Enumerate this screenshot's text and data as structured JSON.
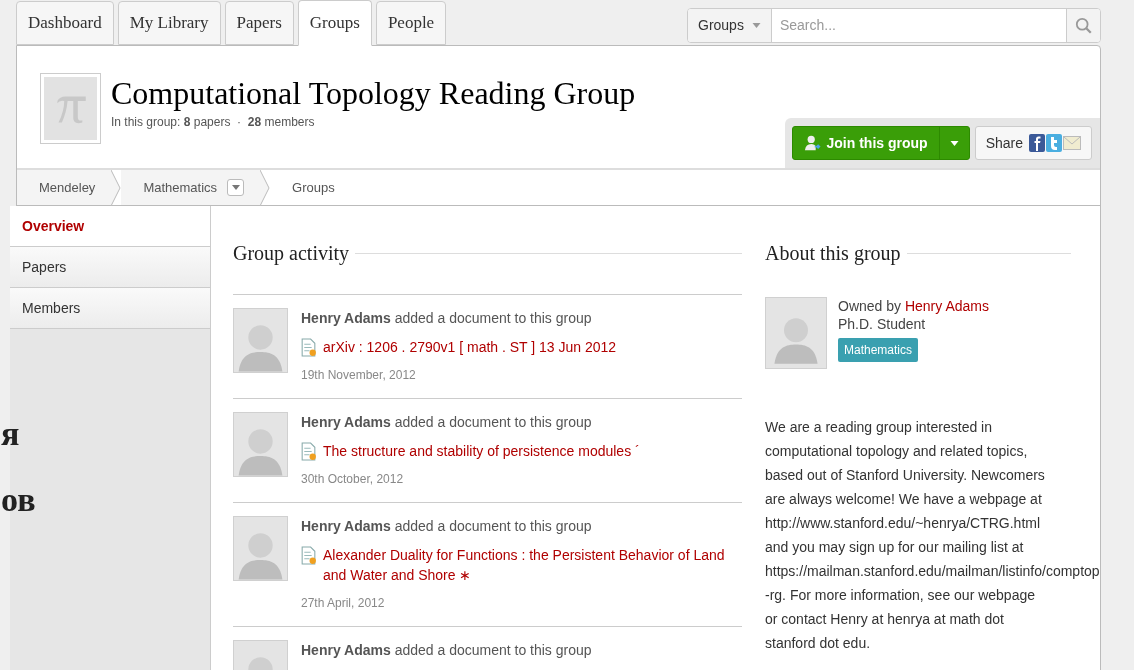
{
  "backdrop_fragments": [
    "я",
    "ов"
  ],
  "tabs": [
    {
      "label": "Dashboard",
      "selected": false
    },
    {
      "label": "My Library",
      "selected": false
    },
    {
      "label": "Papers",
      "selected": false
    },
    {
      "label": "Groups",
      "selected": true
    },
    {
      "label": "People",
      "selected": false
    }
  ],
  "search": {
    "scope": "Groups",
    "placeholder": "Search..."
  },
  "group": {
    "title": "Computational Topology Reading Group",
    "stats": "In this group: **8** papers  ·  **28** members",
    "join_button": "Join this group",
    "share_label": "Share"
  },
  "breadcrumb": [
    {
      "label": "Mendeley",
      "dropdown": false
    },
    {
      "label": "Mathematics",
      "dropdown": true
    },
    {
      "label": "Groups",
      "dropdown": false
    }
  ],
  "sidebar": {
    "items": [
      {
        "label": "Overview",
        "selected": true
      },
      {
        "label": "Papers",
        "selected": false
      },
      {
        "label": "Members",
        "selected": false
      }
    ]
  },
  "activity": {
    "title": "Group activity",
    "items": [
      {
        "summary": "**Henry Adams** added a document to this group",
        "document": "arXiv : 1206 . 2790v1 [ math . ST ] 13 Jun 2012",
        "date": "19th November, 2012"
      },
      {
        "summary": "**Henry Adams** added a document to this group",
        "document": "The structure and stability of persistence modules ´",
        "date": "30th October, 2012"
      },
      {
        "summary": "**Henry Adams** added a document to this group",
        "document": "Alexander Duality for Functions : the Persistent Behavior of Land and Water and Shore ∗",
        "date": "27th April, 2012"
      },
      {
        "summary": "**Henry Adams** added a document to this group"
      }
    ]
  },
  "about": {
    "title": "About this group",
    "owned_by": "Owned by",
    "owner": "Henry Adams",
    "owner_role": "Ph.D. Student",
    "discipline": "Mathematics",
    "description_lines": [
      "We are a reading group interested in",
      "computational topology and related topics,",
      "based out of Stanford University. Newcomers",
      "are always welcome! We have a webpage at",
      "http://www.stanford.edu/~henrya/CTRG.html",
      "and you may sign up for our mailing list at",
      "https://mailman.stanford.edu/mailman/listinfo/comptop",
      "-rg. For more information, see our webpage",
      "or contact Henry at henrya at math dot",
      "stanford dot edu."
    ]
  }
}
